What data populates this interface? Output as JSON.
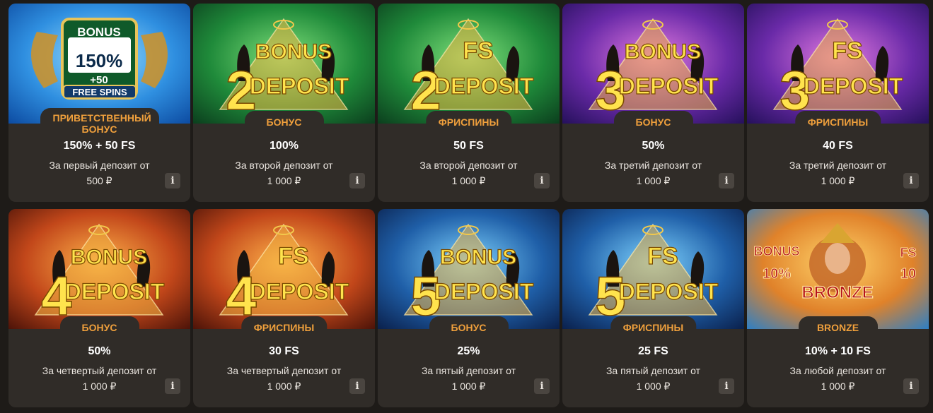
{
  "colors": {
    "background": "#1e1b18",
    "card": "#302c28",
    "tag_text": "#f0a03c",
    "amount_text": "#ffffff",
    "info_button": "#4a4540"
  },
  "cards": [
    {
      "tag": "ПРИВЕТСТВЕННЫЙ БОНУС",
      "amount": "150% + 50 FS",
      "desc": "За первый депозит от",
      "min": "500 ₽",
      "info": "i",
      "art": {
        "theme": "blue",
        "lines": [
          "BONUS",
          "150%",
          "+50",
          "FREE SPINS"
        ]
      }
    },
    {
      "tag": "БОНУС",
      "amount": "100%",
      "desc": "За второй депозит от",
      "min": "1 000 ₽",
      "info": "i",
      "art": {
        "theme": "green",
        "num": "2",
        "word": "BONUS",
        "deposit": "DEPOSIT"
      }
    },
    {
      "tag": "ФРИСПИНЫ",
      "amount": "50 FS",
      "desc": "За второй депозит от",
      "min": "1 000 ₽",
      "info": "i",
      "art": {
        "theme": "green",
        "num": "2",
        "word": "FS",
        "deposit": "DEPOSIT"
      }
    },
    {
      "tag": "БОНУС",
      "amount": "50%",
      "desc": "За третий депозит от",
      "min": "1 000 ₽",
      "info": "i",
      "art": {
        "theme": "purple",
        "num": "3",
        "word": "BONUS",
        "deposit": "DEPOSIT"
      }
    },
    {
      "tag": "ФРИСПИНЫ",
      "amount": "40 FS",
      "desc": "За третий депозит от",
      "min": "1 000 ₽",
      "info": "i",
      "art": {
        "theme": "purple",
        "num": "3",
        "word": "FS",
        "deposit": "DEPOSIT"
      }
    },
    {
      "tag": "БОНУС",
      "amount": "50%",
      "desc": "За четвертый депозит от",
      "min": "1 000 ₽",
      "info": "i",
      "art": {
        "theme": "orange",
        "num": "4",
        "word": "BONUS",
        "deposit": "DEPOSIT"
      }
    },
    {
      "tag": "ФРИСПИНЫ",
      "amount": "30 FS",
      "desc": "За четвертый депозит от",
      "min": "1 000 ₽",
      "info": "i",
      "art": {
        "theme": "orange",
        "num": "4",
        "word": "FS",
        "deposit": "DEPOSIT"
      }
    },
    {
      "tag": "БОНУС",
      "amount": "25%",
      "desc": "За пятый депозит от",
      "min": "1 000 ₽",
      "info": "i",
      "art": {
        "theme": "teal",
        "num": "5",
        "word": "BONUS",
        "deposit": "DEPOSIT"
      }
    },
    {
      "tag": "ФРИСПИНЫ",
      "amount": "25 FS",
      "desc": "За пятый депозит от",
      "min": "1 000 ₽",
      "info": "i",
      "art": {
        "theme": "teal",
        "num": "5",
        "word": "FS",
        "deposit": "DEPOSIT"
      }
    },
    {
      "tag": "BRONZE",
      "amount": "10% + 10 FS",
      "desc": "За любой депозит от",
      "min": "1 000 ₽",
      "info": "i",
      "art": {
        "theme": "bronze",
        "left": [
          "BONUS",
          "10%"
        ],
        "right": [
          "FS",
          "10"
        ],
        "center": "BRONZE"
      }
    }
  ]
}
